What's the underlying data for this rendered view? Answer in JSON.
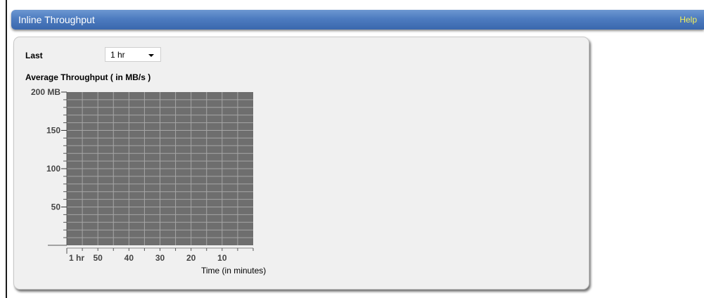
{
  "window": {
    "title": "Inline Throughput",
    "help_label": "Help"
  },
  "filter": {
    "label": "Last",
    "selected": "1 hr"
  },
  "chart_data": {
    "type": "area",
    "title": "Average Throughput ( in MB/s )",
    "xlabel": "Time (in minutes)",
    "ylabel": "",
    "ylim": [
      0,
      200
    ],
    "y_ticks": [
      "200 MB",
      "150",
      "100",
      "50"
    ],
    "y_tick_values": [
      200,
      150,
      100,
      50
    ],
    "x_ticks": [
      "1 hr",
      "50",
      "40",
      "30",
      "20",
      "10"
    ],
    "x_tick_values": [
      60,
      50,
      40,
      30,
      20,
      10
    ],
    "xlim": [
      60,
      0
    ],
    "grid": true,
    "series": []
  }
}
